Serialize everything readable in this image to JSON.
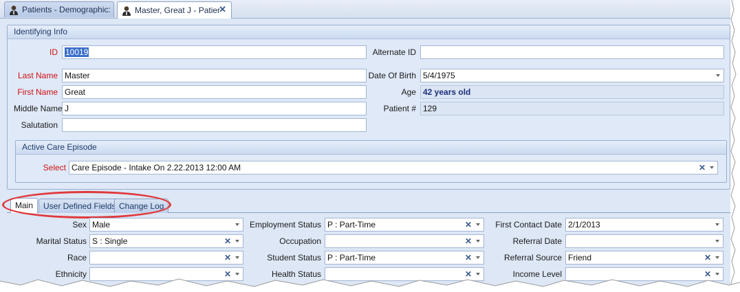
{
  "tabs": [
    {
      "label": "Patients - Demographic:"
    },
    {
      "label": "Master, Great J - Patier"
    }
  ],
  "identifying": {
    "title": "Identifying Info",
    "id_label": "ID",
    "id_value": "10019",
    "alt_id_label": "Alternate ID",
    "alt_id_value": "",
    "last_name_label": "Last Name",
    "last_name_value": "Master",
    "dob_label": "Date Of Birth",
    "dob_value": "5/4/1975",
    "first_name_label": "First Name",
    "first_name_value": "Great",
    "age_label": "Age",
    "age_value": "42 years old",
    "middle_name_label": "Middle Name",
    "middle_name_value": "J",
    "patient_no_label": "Patient #",
    "patient_no_value": "129",
    "salutation_label": "Salutation",
    "salutation_value": ""
  },
  "care_episode": {
    "title": "Active Care Episode",
    "select_label": "Select",
    "select_value": "Care Episode - Intake On 2.22.2013  12:00 AM"
  },
  "detail_tabs": [
    {
      "label": "Main"
    },
    {
      "label": "User Defined Fields"
    },
    {
      "label": "Change Log"
    }
  ],
  "main": {
    "sex_label": "Sex",
    "sex_value": "Male",
    "marital_label": "Marital Status",
    "marital_value": "S : Single",
    "race_label": "Race",
    "race_value": "",
    "ethnicity_label": "Ethnicity",
    "ethnicity_value": "",
    "employment_label": "Employment Status",
    "employment_value": "P : Part-Time",
    "occupation_label": "Occupation",
    "occupation_value": "",
    "student_label": "Student Status",
    "student_value": "P : Part-Time",
    "health_label": "Health Status",
    "health_value": "",
    "first_contact_label": "First Contact Date",
    "first_contact_value": "2/1/2013",
    "referral_date_label": "Referral Date",
    "referral_date_value": "",
    "referral_source_label": "Referral Source",
    "referral_source_value": "Friend",
    "income_label": "Income Level",
    "income_value": ""
  },
  "colors": {
    "required_label": "#d01010",
    "annotation_ellipse": "#e0393c",
    "accent": "#3b6fc9"
  }
}
